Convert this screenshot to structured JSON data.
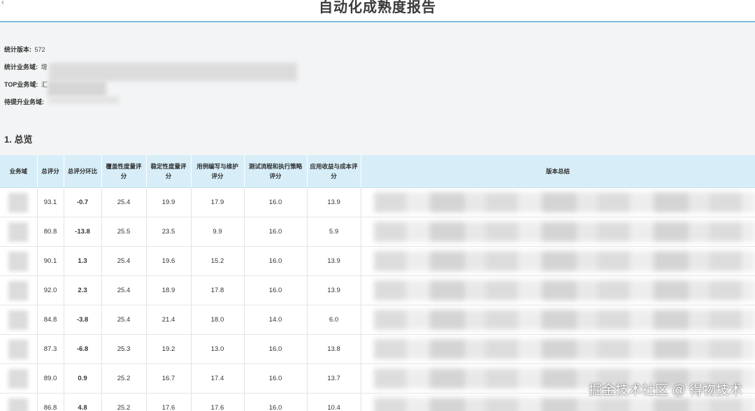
{
  "header": {
    "title": "自动化成熟度报告"
  },
  "stats": {
    "version_label": "统计版本:",
    "version_value": "572",
    "domain_label": "统计业务域:",
    "domain_value": "增",
    "top_label": "TOP业务域:",
    "top_value": "汇",
    "improve_label": "待提升业务域:"
  },
  "section": {
    "heading": "1. 总览"
  },
  "table": {
    "headers": [
      "业务域",
      "总评分",
      "总评分环比",
      "覆盖性度量评分",
      "稳定性度量评分",
      "用例编写与维护评分",
      "测试流程和执行策略评分",
      "应用收益与成本评分",
      "版本总结"
    ],
    "rows": [
      {
        "total": "93.1",
        "change": "-0.7",
        "coverage": "25.4",
        "stability": "19.9",
        "case_writing": "17.9",
        "process": "16.0",
        "benefit": "13.9"
      },
      {
        "total": "80.8",
        "change": "-13.8",
        "coverage": "25.5",
        "stability": "23.5",
        "case_writing": "9.9",
        "process": "16.0",
        "benefit": "5.9"
      },
      {
        "total": "90.1",
        "change": "1.3",
        "coverage": "25.4",
        "stability": "19.6",
        "case_writing": "15.2",
        "process": "16.0",
        "benefit": "13.9"
      },
      {
        "total": "92.0",
        "change": "2.3",
        "coverage": "25.4",
        "stability": "18.9",
        "case_writing": "17.8",
        "process": "16.0",
        "benefit": "13.9"
      },
      {
        "total": "84.8",
        "change": "-3.8",
        "coverage": "25.4",
        "stability": "21.4",
        "case_writing": "18.0",
        "process": "14.0",
        "benefit": "6.0"
      },
      {
        "total": "87.3",
        "change": "-6.8",
        "coverage": "25.3",
        "stability": "19.2",
        "case_writing": "13.0",
        "process": "16.0",
        "benefit": "13.8"
      },
      {
        "total": "89.0",
        "change": "0.9",
        "coverage": "25.2",
        "stability": "16.7",
        "case_writing": "17.4",
        "process": "16.0",
        "benefit": "13.7"
      },
      {
        "total": "86.8",
        "change": "4.8",
        "coverage": "25.2",
        "stability": "17.6",
        "case_writing": "17.6",
        "process": "16.0",
        "benefit": "10.4"
      }
    ]
  },
  "watermark": {
    "text": "掘金技术社区 @ 得物技术"
  },
  "colors": {
    "header_bg": "#d7eef8",
    "title_rule": "#7cbbe2",
    "negative": "#e24b3f",
    "positive": "#2fa852"
  }
}
